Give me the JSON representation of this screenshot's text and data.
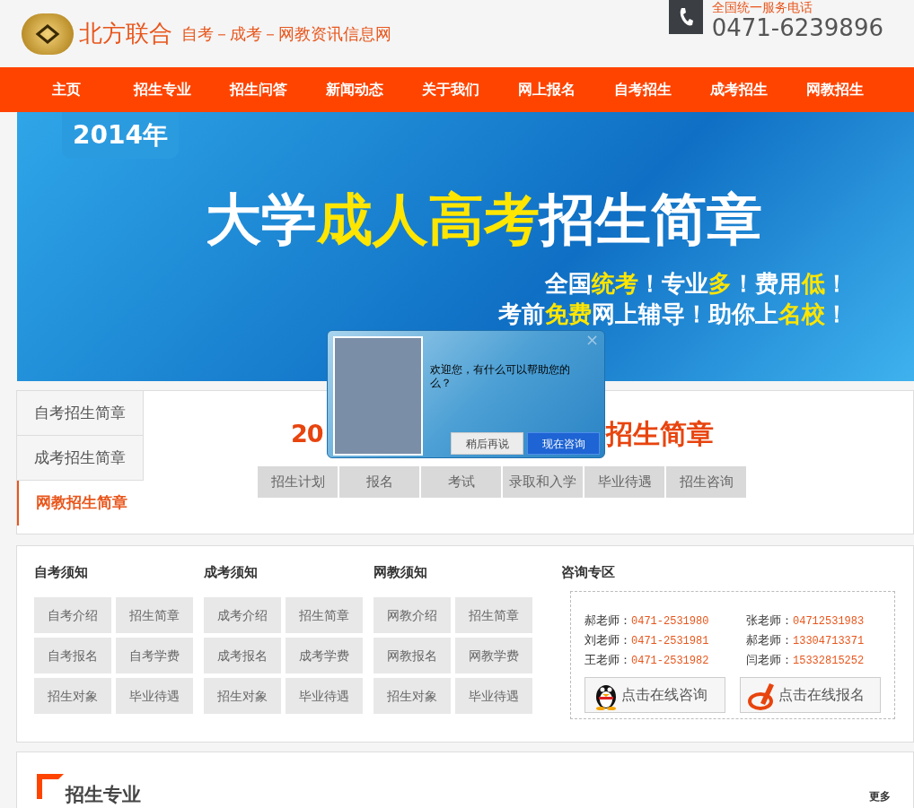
{
  "header": {
    "brand": "北方联合",
    "slogan": "自考－成考－网教资讯信息网",
    "hotline_label": "全国统一服务电话",
    "hotline": "0471-6239896"
  },
  "nav": [
    {
      "label": "主页",
      "selected": false
    },
    {
      "label": "招生专业",
      "selected": false
    },
    {
      "label": "招生问答",
      "selected": false
    },
    {
      "label": "新闻动态",
      "selected": false
    },
    {
      "label": "关于我们",
      "selected": false
    },
    {
      "label": "网上报名",
      "selected": false
    },
    {
      "label": "自考招生",
      "selected": false
    },
    {
      "label": "成考招生",
      "selected": false
    },
    {
      "label": "网教招生",
      "selected": false
    }
  ],
  "banner": {
    "year": "2014年",
    "title": [
      {
        "text": "大学",
        "highlight": false
      },
      {
        "text": "成人高考",
        "highlight": true
      },
      {
        "text": "招生简章",
        "highlight": false
      }
    ],
    "line_1": [
      {
        "text": "全国",
        "highlight": false
      },
      {
        "text": "统考",
        "highlight": true
      },
      {
        "text": "！专业",
        "highlight": false
      },
      {
        "text": "多",
        "highlight": true
      },
      {
        "text": "！费用",
        "highlight": false
      },
      {
        "text": "低",
        "highlight": true
      },
      {
        "text": "！",
        "highlight": false
      }
    ],
    "line_2": [
      {
        "text": "考前",
        "highlight": false
      },
      {
        "text": "免费",
        "highlight": true
      },
      {
        "text": "网上辅导！助你上",
        "highlight": false
      },
      {
        "text": "名校",
        "highlight": true
      },
      {
        "text": "！",
        "highlight": false
      }
    ]
  },
  "side_tabs": [
    {
      "label": "自考招生简章",
      "selected": false
    },
    {
      "label": "成考招生简章",
      "selected": false
    },
    {
      "label": "网教招生简章",
      "selected": true
    }
  ],
  "brochure": {
    "heading_start": "20",
    "heading_end": "招生简章",
    "tabs": [
      "招生计划",
      "报名",
      "考试",
      "录取和入学",
      "毕业待遇",
      "招生咨询"
    ]
  },
  "notices": [
    {
      "title": "自考须知",
      "links": [
        "自考介绍",
        "招生简章",
        "自考报名",
        "自考学费",
        "招生对象",
        "毕业待遇"
      ]
    },
    {
      "title": "成考须知",
      "links": [
        "成考介绍",
        "招生简章",
        "成考报名",
        "成考学费",
        "招生对象",
        "毕业待遇"
      ]
    },
    {
      "title": "网教须知",
      "links": [
        "网教介绍",
        "招生简章",
        "网教报名",
        "网教学费",
        "招生对象",
        "毕业待遇"
      ]
    }
  ],
  "consult": {
    "title": "咨询专区",
    "contacts": [
      {
        "name": "郝老师：",
        "phone": "0471-2531980"
      },
      {
        "name": "张老师：",
        "phone": "04712531983"
      },
      {
        "name": "刘老师：",
        "phone": "0471-2531981"
      },
      {
        "name": "郝老师：",
        "phone": "13304713371"
      },
      {
        "name": "王老师：",
        "phone": "0471-2531982"
      },
      {
        "name": "闫老师：",
        "phone": "15332815252"
      }
    ],
    "buttons": [
      {
        "kind": "chat",
        "label": "点击在线咨询"
      },
      {
        "kind": "signup",
        "label": "点击在线报名"
      }
    ]
  },
  "section": {
    "title": "招生专业",
    "more": "更多"
  },
  "popup": {
    "close": "×",
    "message": "欢迎您，有什么可以帮助您的么？",
    "buttons": [
      {
        "label": "稍后再说",
        "primary": false
      },
      {
        "label": "现在咨询",
        "primary": true
      }
    ]
  }
}
